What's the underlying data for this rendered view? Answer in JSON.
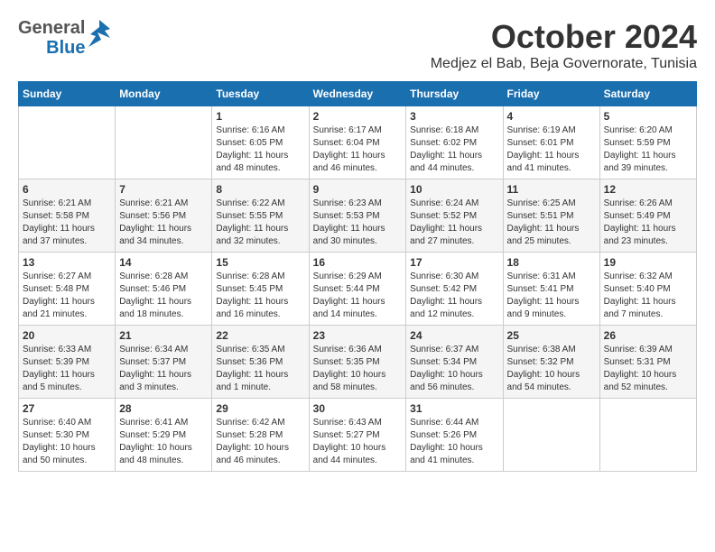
{
  "header": {
    "logo_general": "General",
    "logo_blue": "Blue",
    "month_title": "October 2024",
    "location": "Medjez el Bab, Beja Governorate, Tunisia"
  },
  "calendar": {
    "days_of_week": [
      "Sunday",
      "Monday",
      "Tuesday",
      "Wednesday",
      "Thursday",
      "Friday",
      "Saturday"
    ],
    "weeks": [
      [
        {
          "day": "",
          "sunrise": "",
          "sunset": "",
          "daylight": ""
        },
        {
          "day": "",
          "sunrise": "",
          "sunset": "",
          "daylight": ""
        },
        {
          "day": "1",
          "sunrise": "Sunrise: 6:16 AM",
          "sunset": "Sunset: 6:05 PM",
          "daylight": "Daylight: 11 hours and 48 minutes."
        },
        {
          "day": "2",
          "sunrise": "Sunrise: 6:17 AM",
          "sunset": "Sunset: 6:04 PM",
          "daylight": "Daylight: 11 hours and 46 minutes."
        },
        {
          "day": "3",
          "sunrise": "Sunrise: 6:18 AM",
          "sunset": "Sunset: 6:02 PM",
          "daylight": "Daylight: 11 hours and 44 minutes."
        },
        {
          "day": "4",
          "sunrise": "Sunrise: 6:19 AM",
          "sunset": "Sunset: 6:01 PM",
          "daylight": "Daylight: 11 hours and 41 minutes."
        },
        {
          "day": "5",
          "sunrise": "Sunrise: 6:20 AM",
          "sunset": "Sunset: 5:59 PM",
          "daylight": "Daylight: 11 hours and 39 minutes."
        }
      ],
      [
        {
          "day": "6",
          "sunrise": "Sunrise: 6:21 AM",
          "sunset": "Sunset: 5:58 PM",
          "daylight": "Daylight: 11 hours and 37 minutes."
        },
        {
          "day": "7",
          "sunrise": "Sunrise: 6:21 AM",
          "sunset": "Sunset: 5:56 PM",
          "daylight": "Daylight: 11 hours and 34 minutes."
        },
        {
          "day": "8",
          "sunrise": "Sunrise: 6:22 AM",
          "sunset": "Sunset: 5:55 PM",
          "daylight": "Daylight: 11 hours and 32 minutes."
        },
        {
          "day": "9",
          "sunrise": "Sunrise: 6:23 AM",
          "sunset": "Sunset: 5:53 PM",
          "daylight": "Daylight: 11 hours and 30 minutes."
        },
        {
          "day": "10",
          "sunrise": "Sunrise: 6:24 AM",
          "sunset": "Sunset: 5:52 PM",
          "daylight": "Daylight: 11 hours and 27 minutes."
        },
        {
          "day": "11",
          "sunrise": "Sunrise: 6:25 AM",
          "sunset": "Sunset: 5:51 PM",
          "daylight": "Daylight: 11 hours and 25 minutes."
        },
        {
          "day": "12",
          "sunrise": "Sunrise: 6:26 AM",
          "sunset": "Sunset: 5:49 PM",
          "daylight": "Daylight: 11 hours and 23 minutes."
        }
      ],
      [
        {
          "day": "13",
          "sunrise": "Sunrise: 6:27 AM",
          "sunset": "Sunset: 5:48 PM",
          "daylight": "Daylight: 11 hours and 21 minutes."
        },
        {
          "day": "14",
          "sunrise": "Sunrise: 6:28 AM",
          "sunset": "Sunset: 5:46 PM",
          "daylight": "Daylight: 11 hours and 18 minutes."
        },
        {
          "day": "15",
          "sunrise": "Sunrise: 6:28 AM",
          "sunset": "Sunset: 5:45 PM",
          "daylight": "Daylight: 11 hours and 16 minutes."
        },
        {
          "day": "16",
          "sunrise": "Sunrise: 6:29 AM",
          "sunset": "Sunset: 5:44 PM",
          "daylight": "Daylight: 11 hours and 14 minutes."
        },
        {
          "day": "17",
          "sunrise": "Sunrise: 6:30 AM",
          "sunset": "Sunset: 5:42 PM",
          "daylight": "Daylight: 11 hours and 12 minutes."
        },
        {
          "day": "18",
          "sunrise": "Sunrise: 6:31 AM",
          "sunset": "Sunset: 5:41 PM",
          "daylight": "Daylight: 11 hours and 9 minutes."
        },
        {
          "day": "19",
          "sunrise": "Sunrise: 6:32 AM",
          "sunset": "Sunset: 5:40 PM",
          "daylight": "Daylight: 11 hours and 7 minutes."
        }
      ],
      [
        {
          "day": "20",
          "sunrise": "Sunrise: 6:33 AM",
          "sunset": "Sunset: 5:39 PM",
          "daylight": "Daylight: 11 hours and 5 minutes."
        },
        {
          "day": "21",
          "sunrise": "Sunrise: 6:34 AM",
          "sunset": "Sunset: 5:37 PM",
          "daylight": "Daylight: 11 hours and 3 minutes."
        },
        {
          "day": "22",
          "sunrise": "Sunrise: 6:35 AM",
          "sunset": "Sunset: 5:36 PM",
          "daylight": "Daylight: 11 hours and 1 minute."
        },
        {
          "day": "23",
          "sunrise": "Sunrise: 6:36 AM",
          "sunset": "Sunset: 5:35 PM",
          "daylight": "Daylight: 10 hours and 58 minutes."
        },
        {
          "day": "24",
          "sunrise": "Sunrise: 6:37 AM",
          "sunset": "Sunset: 5:34 PM",
          "daylight": "Daylight: 10 hours and 56 minutes."
        },
        {
          "day": "25",
          "sunrise": "Sunrise: 6:38 AM",
          "sunset": "Sunset: 5:32 PM",
          "daylight": "Daylight: 10 hours and 54 minutes."
        },
        {
          "day": "26",
          "sunrise": "Sunrise: 6:39 AM",
          "sunset": "Sunset: 5:31 PM",
          "daylight": "Daylight: 10 hours and 52 minutes."
        }
      ],
      [
        {
          "day": "27",
          "sunrise": "Sunrise: 6:40 AM",
          "sunset": "Sunset: 5:30 PM",
          "daylight": "Daylight: 10 hours and 50 minutes."
        },
        {
          "day": "28",
          "sunrise": "Sunrise: 6:41 AM",
          "sunset": "Sunset: 5:29 PM",
          "daylight": "Daylight: 10 hours and 48 minutes."
        },
        {
          "day": "29",
          "sunrise": "Sunrise: 6:42 AM",
          "sunset": "Sunset: 5:28 PM",
          "daylight": "Daylight: 10 hours and 46 minutes."
        },
        {
          "day": "30",
          "sunrise": "Sunrise: 6:43 AM",
          "sunset": "Sunset: 5:27 PM",
          "daylight": "Daylight: 10 hours and 44 minutes."
        },
        {
          "day": "31",
          "sunrise": "Sunrise: 6:44 AM",
          "sunset": "Sunset: 5:26 PM",
          "daylight": "Daylight: 10 hours and 41 minutes."
        },
        {
          "day": "",
          "sunrise": "",
          "sunset": "",
          "daylight": ""
        },
        {
          "day": "",
          "sunrise": "",
          "sunset": "",
          "daylight": ""
        }
      ]
    ]
  }
}
